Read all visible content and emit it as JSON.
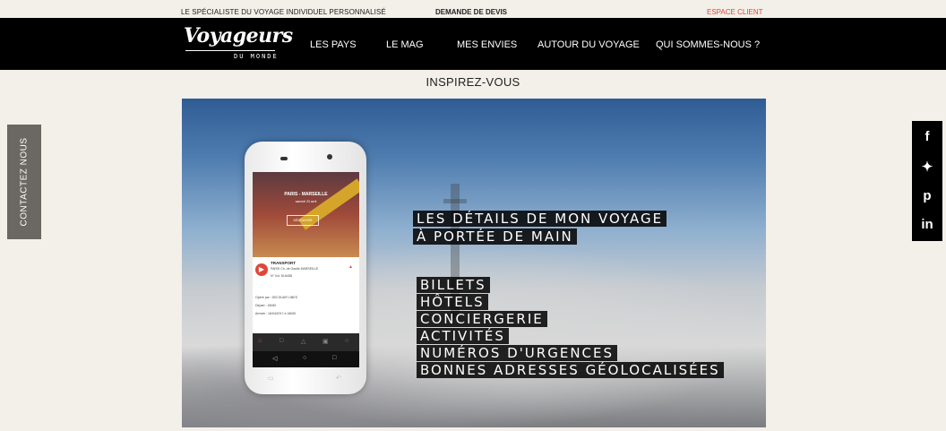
{
  "topbar": {
    "tagline": "LE SPÉCIALISTE DU VOYAGE INDIVIDUEL PERSONNALISÉ",
    "quote_link": "DEMANDE DE DEVIS",
    "client_link": "ESPACE CLIENT",
    "client_color": "#e0473a"
  },
  "logo": {
    "name": "Voyageurs",
    "sub": "DU MONDE"
  },
  "nav": {
    "items": [
      "LES PAYS",
      "LE MAG",
      "MES ENVIES",
      "AUTOUR DU VOYAGE",
      "QUI SOMMES-NOUS ?"
    ]
  },
  "section_title": "INSPIREZ-VOUS",
  "hero": {
    "headline": [
      "LES DÉTAILS DE MON VOYAGE",
      "À PORTÉE DE MAIN"
    ],
    "features": [
      "BILLETS",
      "HÔTELS",
      "CONCIERGERIE",
      "ACTIVITÉS",
      "NUMÉROS D'URGENCES",
      "BONNES ADRESSES GÉOLOCALISÉES"
    ],
    "phone": {
      "route": "PARIS - MARSEILLE",
      "date": "samedi 23 avril",
      "button": "DÉCOUVRIR",
      "transport_title": "TRANSPORT",
      "transport_line1": "PARIS Ch. de Gaulle MARSEILLE",
      "transport_line2": "N° Vol: DL8458",
      "details": [
        "Opéré par : DELTA AIR LINES",
        "Départ : 15h50",
        "Arrivée : 16/04/2017 à 16h50"
      ]
    }
  },
  "contact_tab": "CONTACTEZ NOUS",
  "social": [
    "facebook-icon",
    "twitter-icon",
    "pinterest-icon",
    "linkedin-icon"
  ]
}
